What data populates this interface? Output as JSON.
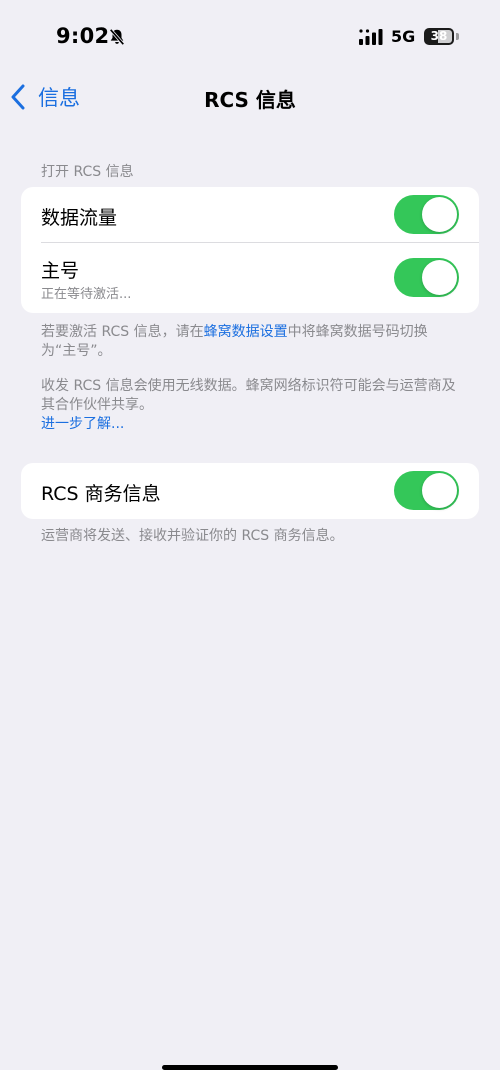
{
  "status_bar": {
    "time": "9:02",
    "network": "5G",
    "battery": "38"
  },
  "nav": {
    "back_label": "信息",
    "title": "RCS 信息"
  },
  "section1": {
    "header": "打开 RCS 信息",
    "rows": [
      {
        "title": "数据流量",
        "toggle_on": true
      },
      {
        "title": "主号",
        "subtitle": "正在等待激活...",
        "toggle_on": true
      }
    ]
  },
  "footer1": {
    "part1": "若要激活 RCS 信息，请在",
    "link": "蜂窝数据设置",
    "part2": "中将蜂窝数据号码切换为“主号”。"
  },
  "footer2": {
    "text": "收发 RCS 信息会使用无线数据。蜂窝网络标识符可能会与运营商及其合作伙伴共享。",
    "link": "进一步了解..."
  },
  "section2": {
    "rows": [
      {
        "title": "RCS 商务信息",
        "toggle_on": true
      }
    ]
  },
  "footer3": {
    "text": "运营商将发送、接收并验证你的 RCS 商务信息。"
  },
  "colors": {
    "accent": "#1b6fe0",
    "toggle_on": "#34c759",
    "background": "#f0eff5"
  }
}
